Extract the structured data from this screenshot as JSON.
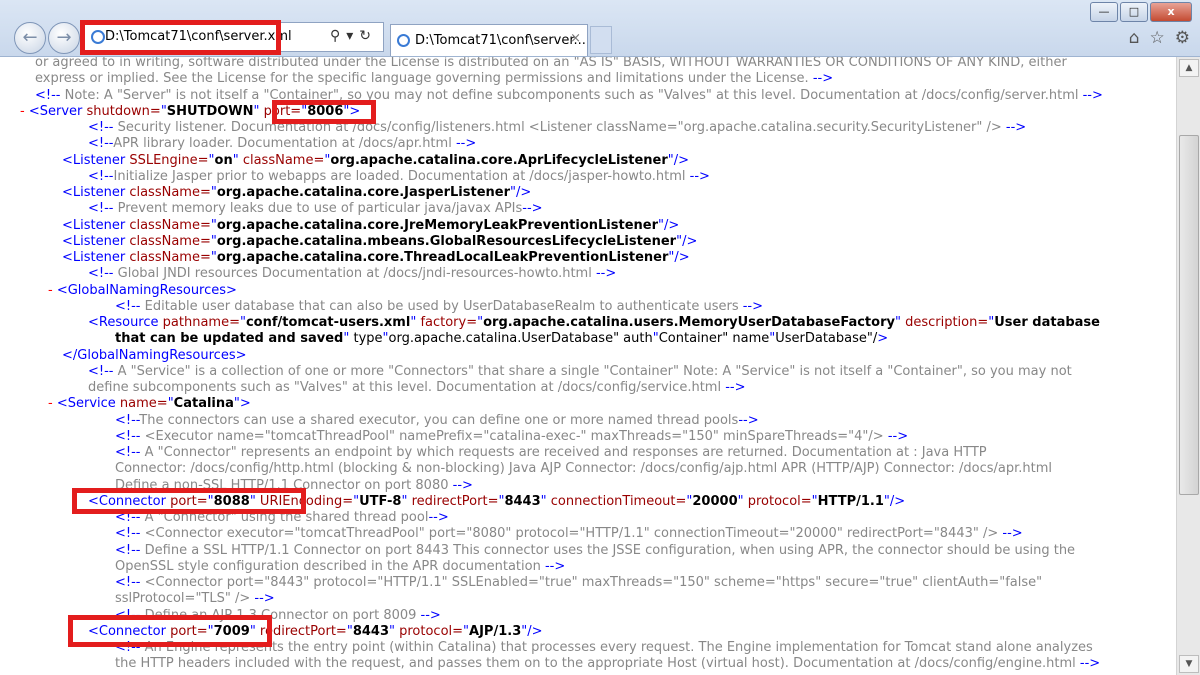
{
  "window": {
    "address": "D:\\Tomcat71\\conf\\server.xml",
    "tab_title": "D:\\Tomcat71\\conf\\server...",
    "tab_close": "×",
    "minimize": "—",
    "maximize": "□",
    "close": "x"
  },
  "lines": [
    [
      "c",
      "or agreed to in writing, software distributed under the License is distributed on an \"AS IS\" BASIS, WITHOUT WARRANTIES OR CONDITIONS OF ANY KIND, either"
    ],
    [
      "c",
      "express or implied. See the License for the specific language governing permissions and limitations under the License. -->"
    ],
    [
      "c",
      "<!-- Note: A \"Server\" is not itself a \"Container\", so you may not define subcomponents such as \"Valves\" at this level. Documentation at /docs/config/server.html -->"
    ],
    [
      "s",
      "- <Server shutdown=\"SHUTDOWN\" port=\"8006\">"
    ],
    [
      "c",
      "<!-- Security listener. Documentation at /docs/config/listeners.html <Listener className=\"org.apache.catalina.security.SecurityListener\" /> -->"
    ],
    [
      "c",
      "<!--APR library loader. Documentation at /docs/apr.html -->"
    ],
    [
      "t",
      "<Listener SSLEngine=\"on\" className=\"org.apache.catalina.core.AprLifecycleListener\"/>"
    ],
    [
      "c",
      "<!--Initialize Jasper prior to webapps are loaded. Documentation at /docs/jasper-howto.html -->"
    ],
    [
      "t",
      "<Listener className=\"org.apache.catalina.core.JasperListener\"/>"
    ],
    [
      "c",
      "<!-- Prevent memory leaks due to use of particular java/javax APIs-->"
    ],
    [
      "t",
      "<Listener className=\"org.apache.catalina.core.JreMemoryLeakPreventionListener\"/>"
    ],
    [
      "t",
      "<Listener className=\"org.apache.catalina.mbeans.GlobalResourcesLifecycleListener\"/>"
    ],
    [
      "t",
      "<Listener className=\"org.apache.catalina.core.ThreadLocalLeakPreventionListener\"/>"
    ],
    [
      "c",
      "<!-- Global JNDI resources Documentation at /docs/jndi-resources-howto.html -->"
    ],
    [
      "s",
      "- <GlobalNamingResources>"
    ],
    [
      "c",
      "<!-- Editable user database that can also be used by UserDatabaseRealm to authenticate users -->"
    ],
    [
      "t",
      "<Resource pathname=\"conf/tomcat-users.xml\" factory=\"org.apache.catalina.users.MemoryUserDatabaseFactory\" description=\"User database"
    ],
    [
      "t",
      "that can be updated and saved\" type=\"org.apache.catalina.UserDatabase\" auth=\"Container\" name=\"UserDatabase\"/>"
    ],
    [
      "t",
      "</GlobalNamingResources>"
    ],
    [
      "c",
      "<!-- A \"Service\" is a collection of one or more \"Connectors\" that share a single \"Container\" Note: A \"Service\" is not itself a \"Container\", so you may not"
    ],
    [
      "c",
      "define subcomponents such as \"Valves\" at this level. Documentation at /docs/config/service.html -->"
    ],
    [
      "s",
      "- <Service name=\"Catalina\">"
    ],
    [
      "c",
      "<!--The connectors can use a shared executor, you can define one or more named thread pools-->"
    ],
    [
      "c",
      "<!-- <Executor name=\"tomcatThreadPool\" namePrefix=\"catalina-exec-\" maxThreads=\"150\" minSpareThreads=\"4\"/> -->"
    ],
    [
      "c",
      "<!-- A \"Connector\" represents an endpoint by which requests are received and responses are returned. Documentation at : Java HTTP"
    ],
    [
      "c",
      "Connector: /docs/config/http.html (blocking & non-blocking) Java AJP Connector: /docs/config/ajp.html APR (HTTP/AJP) Connector: /docs/apr.html"
    ],
    [
      "c",
      "Define a non-SSL HTTP/1.1 Connector on port 8080 -->"
    ],
    [
      "t",
      "<Connector port=\"8088\" URIEncoding=\"UTF-8\" redirectPort=\"8443\" connectionTimeout=\"20000\" protocol=\"HTTP/1.1\"/>"
    ],
    [
      "c",
      "<!-- A \"Connector\" using the shared thread pool-->"
    ],
    [
      "c",
      "<!-- <Connector executor=\"tomcatThreadPool\" port=\"8080\" protocol=\"HTTP/1.1\" connectionTimeout=\"20000\" redirectPort=\"8443\" /> -->"
    ],
    [
      "c",
      "<!-- Define a SSL HTTP/1.1 Connector on port 8443 This connector uses the JSSE configuration, when using APR, the connector should be using the"
    ],
    [
      "c",
      "OpenSSL style configuration described in the APR documentation -->"
    ],
    [
      "c",
      "<!-- <Connector port=\"8443\" protocol=\"HTTP/1.1\" SSLEnabled=\"true\" maxThreads=\"150\" scheme=\"https\" secure=\"true\" clientAuth=\"false\""
    ],
    [
      "c",
      "sslProtocol=\"TLS\" /> -->"
    ],
    [
      "c",
      "<!-- Define an AJP 1.3 Connector on port 8009 -->"
    ],
    [
      "t",
      "<Connector port=\"7009\" redirectPort=\"8443\" protocol=\"AJP/1.3\"/>"
    ],
    [
      "c",
      "<!-- An Engine represents the entry point (within Catalina) that processes every request. The Engine implementation for Tomcat stand alone analyzes"
    ],
    [
      "c",
      "the HTTP headers included with the request, and passes them on to the appropriate Host (virtual host). Documentation at /docs/config/engine.html -->"
    ]
  ]
}
